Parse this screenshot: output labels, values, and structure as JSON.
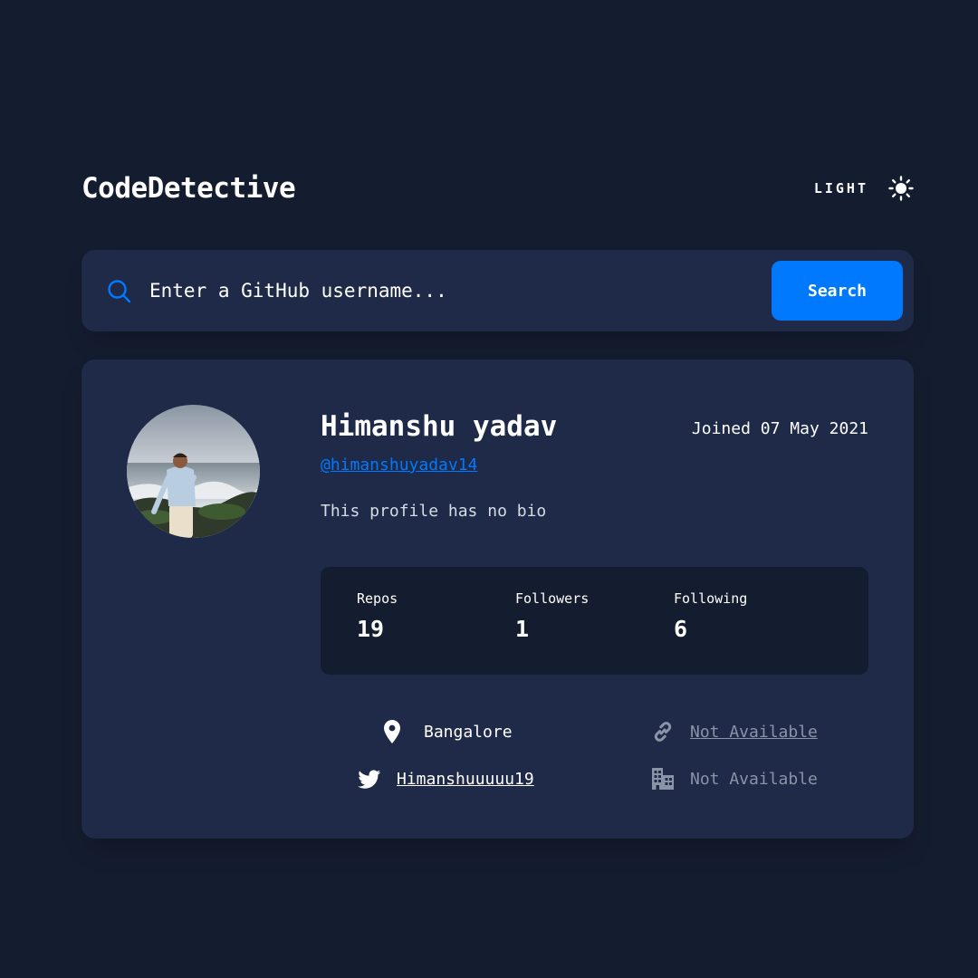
{
  "header": {
    "logo": "CodeDetective",
    "theme_label": "LIGHT",
    "theme_icon": "sun-icon"
  },
  "search": {
    "icon": "search-icon",
    "placeholder": "Enter a GitHub username...",
    "value": "",
    "button_label": "Search"
  },
  "profile": {
    "name": "Himanshu yadav",
    "login": "@himanshuyadav14",
    "joined": "Joined 07 May 2021",
    "bio": "This profile has no bio",
    "stats": [
      {
        "label": "Repos",
        "value": "19"
      },
      {
        "label": "Followers",
        "value": "1"
      },
      {
        "label": "Following",
        "value": "6"
      }
    ],
    "links": {
      "location": {
        "icon": "location-pin-icon",
        "text": "Bangalore"
      },
      "website": {
        "icon": "link-icon",
        "text": "Not Available"
      },
      "twitter": {
        "icon": "twitter-icon",
        "text": "Himanshuuuuu19"
      },
      "company": {
        "icon": "company-building-icon",
        "text": "Not Available"
      }
    }
  },
  "colors": {
    "background": "#141c2f",
    "card": "#1e2a47",
    "stats_panel": "#141d2f",
    "accent": "#0079ff",
    "muted_text": "#8a94a6"
  }
}
